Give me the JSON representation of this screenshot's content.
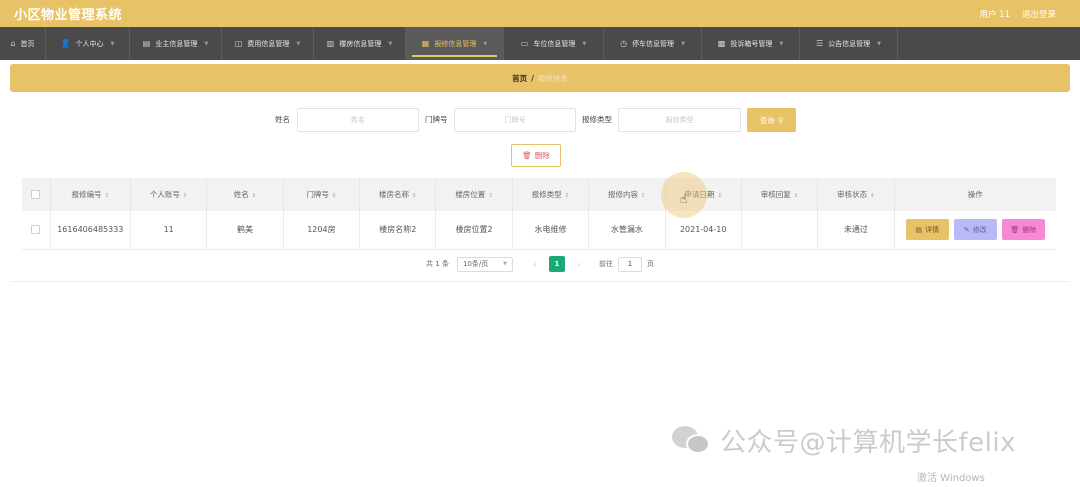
{
  "app": {
    "title": "小区物业管理系统"
  },
  "header": {
    "user_label": "用户 11",
    "logout_label": "退出登录"
  },
  "nav": {
    "items": [
      {
        "label": "首页",
        "icon": "home-icon",
        "glyph": "⌂",
        "active": false
      },
      {
        "label": "个人中心",
        "icon": "user-icon",
        "glyph": "👤",
        "active": false
      },
      {
        "label": "业主信息管理",
        "icon": "owner-icon",
        "glyph": "▤",
        "active": false
      },
      {
        "label": "费用信息管理",
        "icon": "fee-icon",
        "glyph": "◫",
        "active": false
      },
      {
        "label": "楼房信息管理",
        "icon": "building-icon",
        "glyph": "▥",
        "active": false
      },
      {
        "label": "报修信息管理",
        "icon": "repair-icon",
        "glyph": "▦",
        "active": true
      },
      {
        "label": "车位信息管理",
        "icon": "parking-icon",
        "glyph": "▭",
        "active": false
      },
      {
        "label": "停车信息管理",
        "icon": "car-icon",
        "glyph": "◷",
        "active": false
      },
      {
        "label": "投诉箱号管理",
        "icon": "complaint-icon",
        "glyph": "▩",
        "active": false
      },
      {
        "label": "公告信息管理",
        "icon": "notice-icon",
        "glyph": "☰",
        "active": false
      }
    ]
  },
  "breadcrumb": {
    "home": "首页",
    "separator": "/",
    "current": "报修信息"
  },
  "search": {
    "fields": [
      {
        "label": "姓名",
        "placeholder": "姓名"
      },
      {
        "label": "门牌号",
        "placeholder": "门牌号"
      },
      {
        "label": "报修类型",
        "placeholder": "报修类型"
      }
    ],
    "button_label": "查询",
    "button_icon": "search-icon"
  },
  "bulk_delete": {
    "label": "删除",
    "icon": "trash-icon"
  },
  "table": {
    "columns": [
      "报修编号",
      "个人账号",
      "姓名",
      "门牌号",
      "楼房名称",
      "楼房位置",
      "报修类型",
      "报修内容",
      "申请日期",
      "审核回复",
      "审核状态",
      "操作"
    ],
    "rows": [
      [
        "1616406485333",
        "11",
        "鹤美",
        "1204房",
        "楼房名称2",
        "楼房位置2",
        "水电维修",
        "水管漏水",
        "2021-04-10",
        "",
        "未通过"
      ]
    ],
    "actions": {
      "detail": "详情",
      "edit": "修改",
      "delete": "删除"
    }
  },
  "pagination": {
    "total": "共 1 条",
    "page_size": "10条/页",
    "prev": "‹",
    "current": "1",
    "next": "›",
    "goto_label": "前往",
    "goto_value": "1",
    "page_unit": "页"
  },
  "watermark": "公众号@计算机学长felix",
  "windows_activation": "激活 Windows",
  "colors": {
    "accent": "#e8c266",
    "nav_bg": "#4a4a4a",
    "page_active": "#1aaa74",
    "edit": "#b9b9f5",
    "delete": "#f589d6"
  }
}
